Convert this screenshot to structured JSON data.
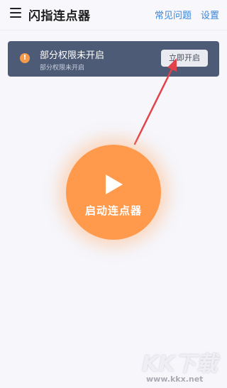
{
  "header": {
    "title": "闪指连点器",
    "faq_label": "常见问题",
    "settings_label": "设置"
  },
  "banner": {
    "title": "部分权限未开启",
    "subtitle": "部分权限未开启",
    "button_label": "立即开启"
  },
  "main": {
    "start_label": "启动连点器"
  },
  "watermark": {
    "logo": "KK下载",
    "url": "www.kkx.net"
  },
  "colors": {
    "accent": "#ff9a4d",
    "banner_bg": "#4e5b76",
    "link": "#3b86d6",
    "arrow": "#e2424a"
  }
}
